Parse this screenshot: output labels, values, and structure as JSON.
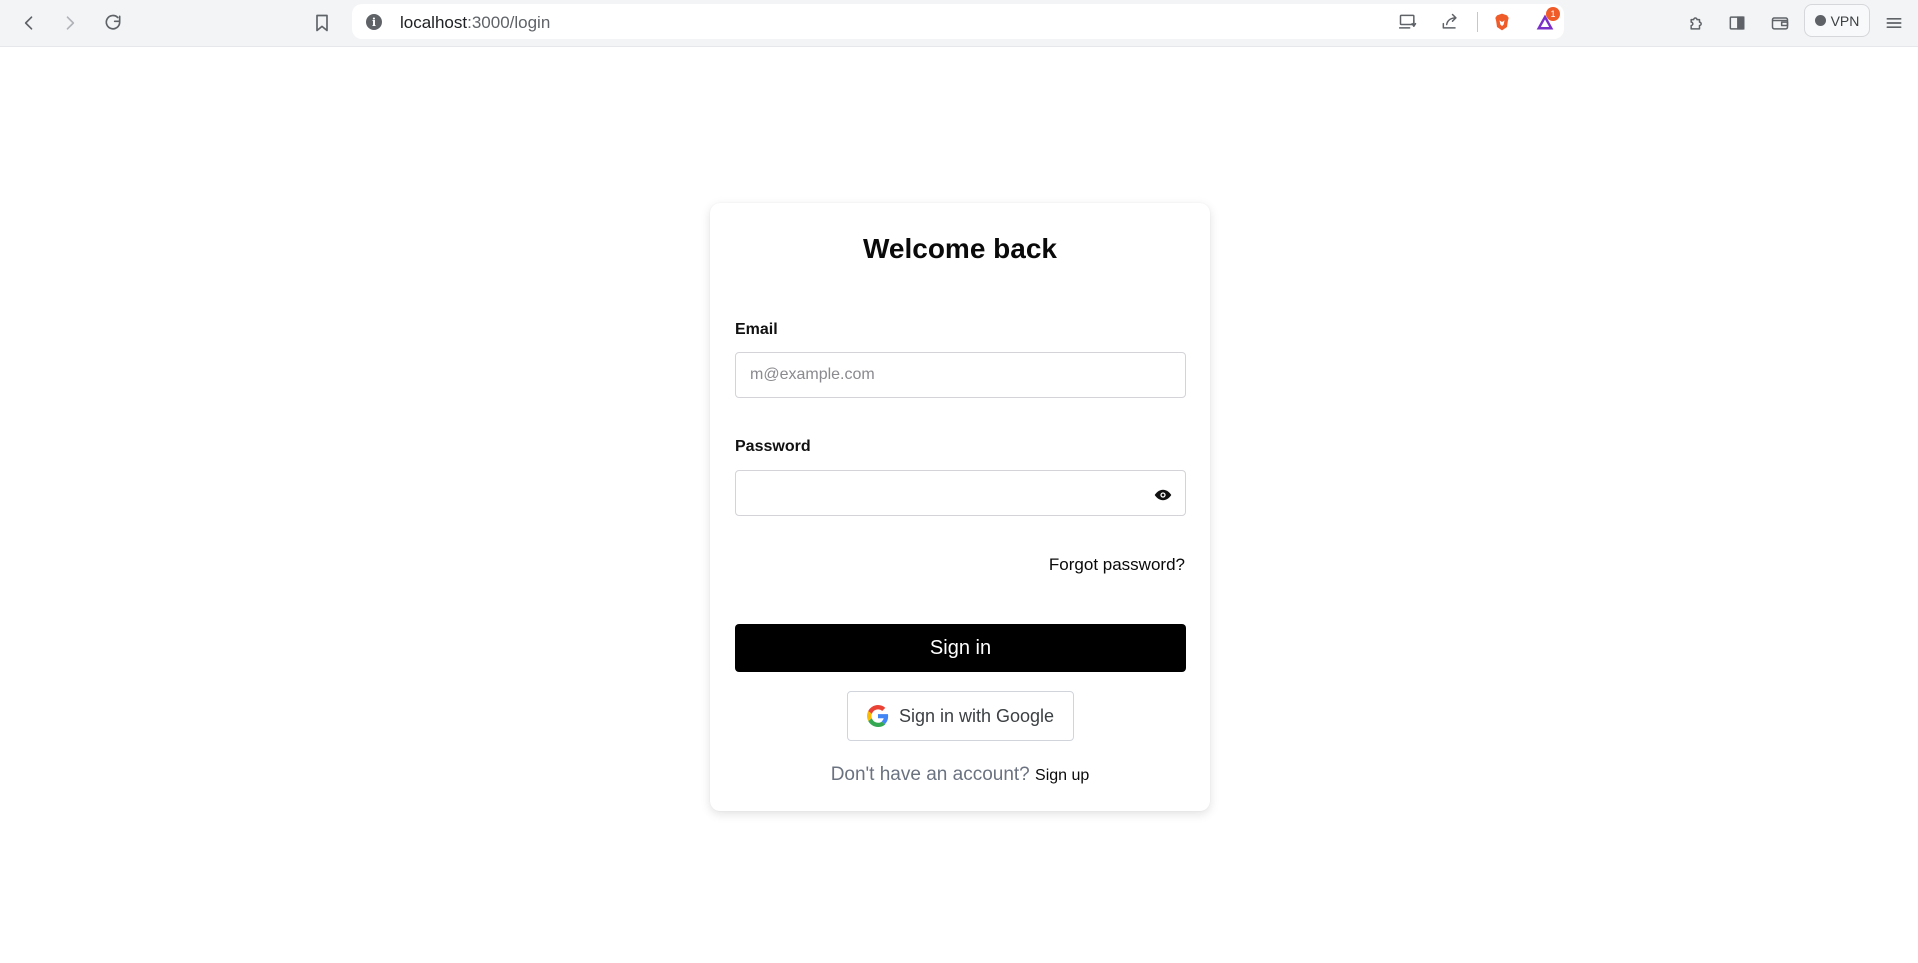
{
  "browser": {
    "url_host": "localhost",
    "url_path": ":3000/login",
    "notification_count": "1",
    "vpn_label": "VPN"
  },
  "login": {
    "title": "Welcome back",
    "email_label": "Email",
    "email_placeholder": "m@example.com",
    "email_value": "",
    "password_label": "Password",
    "password_value": "",
    "forgot_label": "Forgot password?",
    "signin_label": "Sign in",
    "google_label": "Sign in with Google",
    "no_account_text": "Don't have an account?",
    "signup_label": "Sign up"
  },
  "colors": {
    "primary_button": "#000000",
    "brave_orange": "#f05b2a",
    "muted_text": "#6b7280"
  }
}
